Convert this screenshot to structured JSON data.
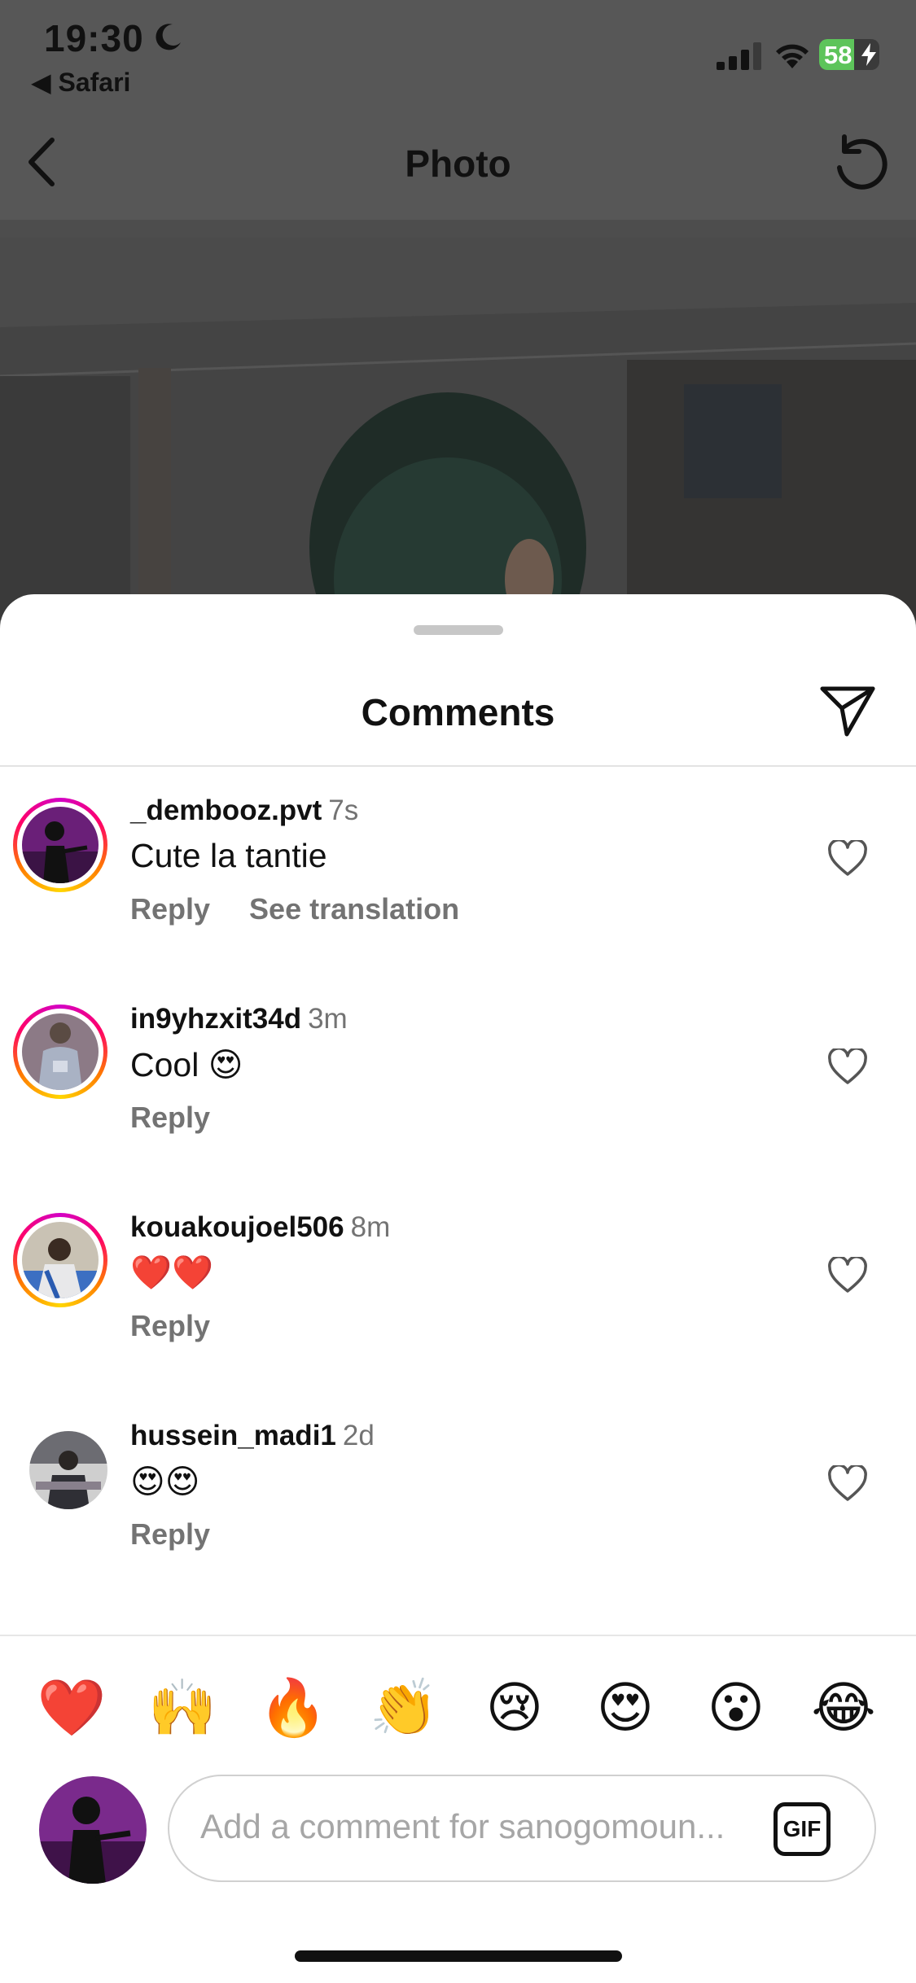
{
  "status": {
    "time": "19:30",
    "back_to_app": "◀ Safari",
    "battery": "58",
    "battery_level": 0.58
  },
  "nav": {
    "title": "Photo"
  },
  "sheet": {
    "title": "Comments"
  },
  "comments": [
    {
      "user": "_dembooz.pvt",
      "time": "7s",
      "text": "Cute la tantie",
      "reply": "Reply",
      "translate": "See translation",
      "story_ring": true
    },
    {
      "user": "in9yhzxit34d",
      "time": "3m",
      "text": "Cool 😍",
      "reply": "Reply",
      "story_ring": true
    },
    {
      "user": "kouakoujoel506",
      "time": "8m",
      "text": "❤️❤️",
      "reply": "Reply",
      "story_ring": true
    },
    {
      "user": "hussein_madi1",
      "time": "2d",
      "text": "😍😍",
      "reply": "Reply",
      "story_ring": false
    }
  ],
  "emoji_bar": [
    "❤️",
    "🙌",
    "🔥",
    "👏",
    "😢",
    "😍",
    "😮",
    "😂"
  ],
  "compose": {
    "placeholder": "Add a comment for sanogomoun...",
    "gif_label": "GIF"
  },
  "icons": {
    "back": "chevron-left-icon",
    "refresh": "refresh-icon",
    "share": "paper-plane-icon",
    "like": "heart-outline-icon"
  },
  "colors": {
    "ring_gradient": [
      "#d300c5",
      "#ff0069",
      "#ff7a00",
      "#ffd600"
    ],
    "battery": "#5dc45a",
    "secondary_text": "#737373"
  }
}
